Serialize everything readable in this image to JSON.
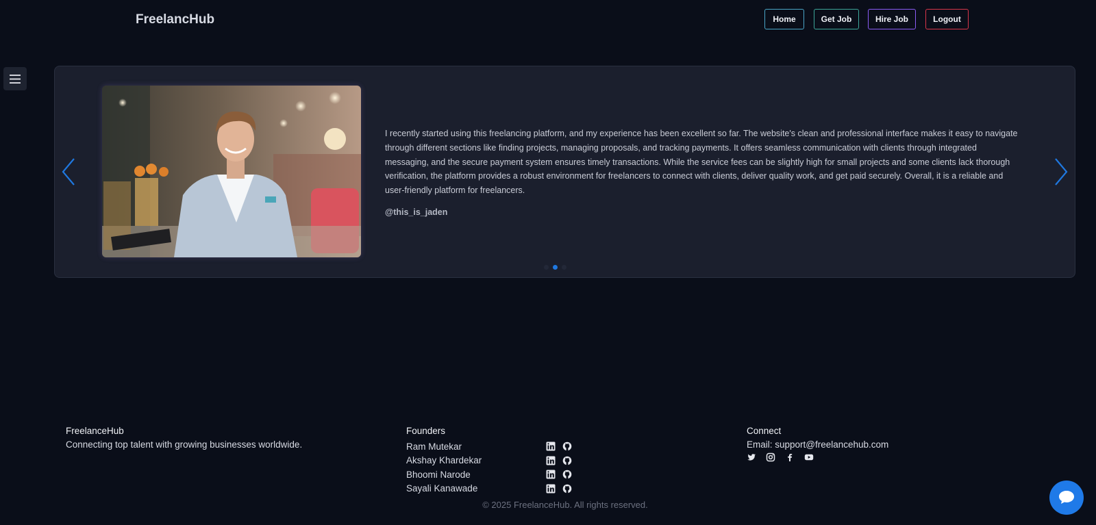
{
  "header": {
    "brand": "FreelancHub",
    "nav": {
      "home": "Home",
      "get_job": "Get Job",
      "hire_job": "Hire Job",
      "logout": "Logout"
    },
    "nav_colors": {
      "home": "#4aa6c8",
      "get_job": "#3da79a",
      "hire_job": "#8b5cf6",
      "logout": "#d9364a"
    }
  },
  "menu": {
    "icon": "hamburger-icon"
  },
  "testimonial": {
    "quote": "I recently started using this freelancing platform, and my experience has been excellent so far. The website's clean and professional interface makes it easy to navigate through different sections like finding projects, managing proposals, and tracking payments. It offers seamless communication with clients through integrated messaging, and the secure payment system ensures timely transactions. While the service fees can be slightly high for small projects and some clients lack thorough verification, the platform provides a robust environment for freelancers to connect with clients, deliver quality work, and get paid securely. Overall, it is a reliable and user-friendly platform for freelancers.",
    "handle": "@this_is_jaden",
    "slide_count": 3,
    "active_slide": 2,
    "accent_color": "#1f78e0"
  },
  "footer": {
    "about": {
      "title": "FreelanceHub",
      "tagline": "Connecting top talent with growing businesses worldwide."
    },
    "founders": {
      "title": "Founders",
      "people": [
        {
          "name": "Ram Mutekar"
        },
        {
          "name": "Akshay Khardekar"
        },
        {
          "name": "Bhoomi Narode"
        },
        {
          "name": "Sayali Kanawade"
        }
      ]
    },
    "connect": {
      "title": "Connect",
      "email": "Email: support@freelancehub.com",
      "social": [
        "twitter-icon",
        "instagram-icon",
        "facebook-icon",
        "youtube-icon"
      ]
    },
    "copyright": "© 2025 FreelanceHub. All rights reserved."
  },
  "chat": {
    "icon": "chat-bubble-icon",
    "color": "#1f7ae8"
  }
}
